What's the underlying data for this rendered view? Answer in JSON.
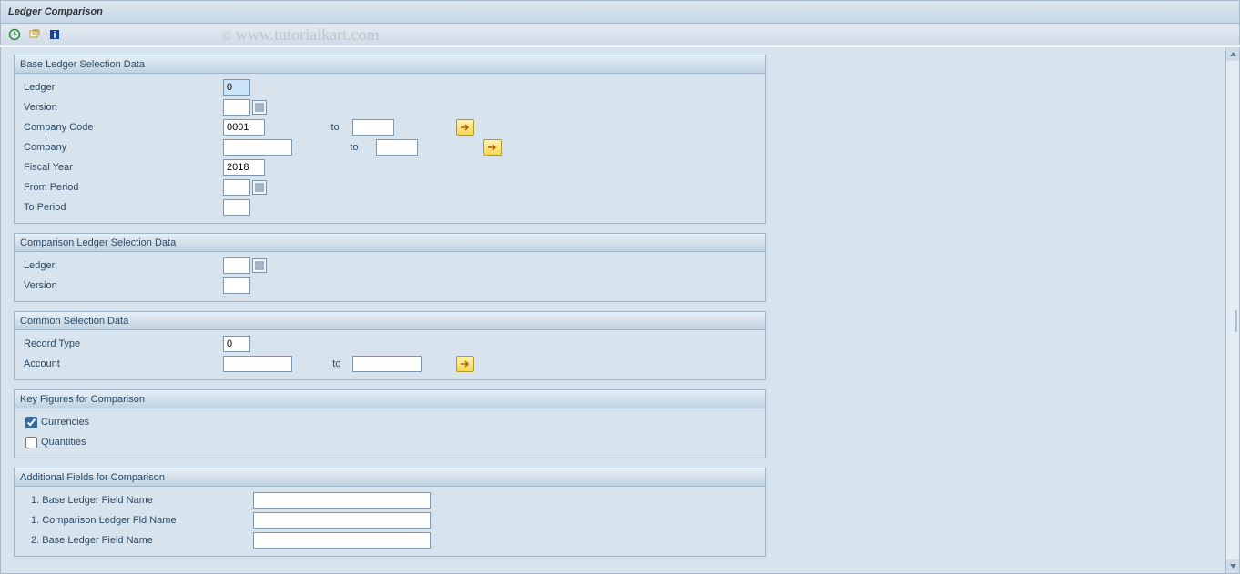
{
  "title": "Ledger Comparison",
  "watermark": "© www.tutorialkart.com",
  "groups": {
    "base": {
      "title": "Base Ledger Selection Data",
      "ledger_label": "Ledger",
      "ledger_value": "0",
      "version_label": "Version",
      "company_code_label": "Company Code",
      "company_code_value": "0001",
      "company_label": "Company",
      "fiscal_year_label": "Fiscal Year",
      "fiscal_year_value": "2018",
      "from_period_label": "From Period",
      "to_period_label": "To Period",
      "to_text": "to"
    },
    "comp": {
      "title": "Comparison Ledger Selection Data",
      "ledger_label": "Ledger",
      "version_label": "Version"
    },
    "common": {
      "title": "Common Selection Data",
      "record_type_label": "Record Type",
      "record_type_value": "0",
      "account_label": "Account",
      "to_text": "to"
    },
    "keyfig": {
      "title": "Key Figures for Comparison",
      "currencies_label": "Currencies",
      "currencies_checked": true,
      "quantities_label": "Quantities",
      "quantities_checked": false
    },
    "addl": {
      "title": "Additional Fields for Comparison",
      "row1a": "1. Base Ledger Field Name",
      "row1b": "1. Comparison Ledger Fld Name",
      "row2a": "2. Base Ledger Field Name"
    }
  }
}
